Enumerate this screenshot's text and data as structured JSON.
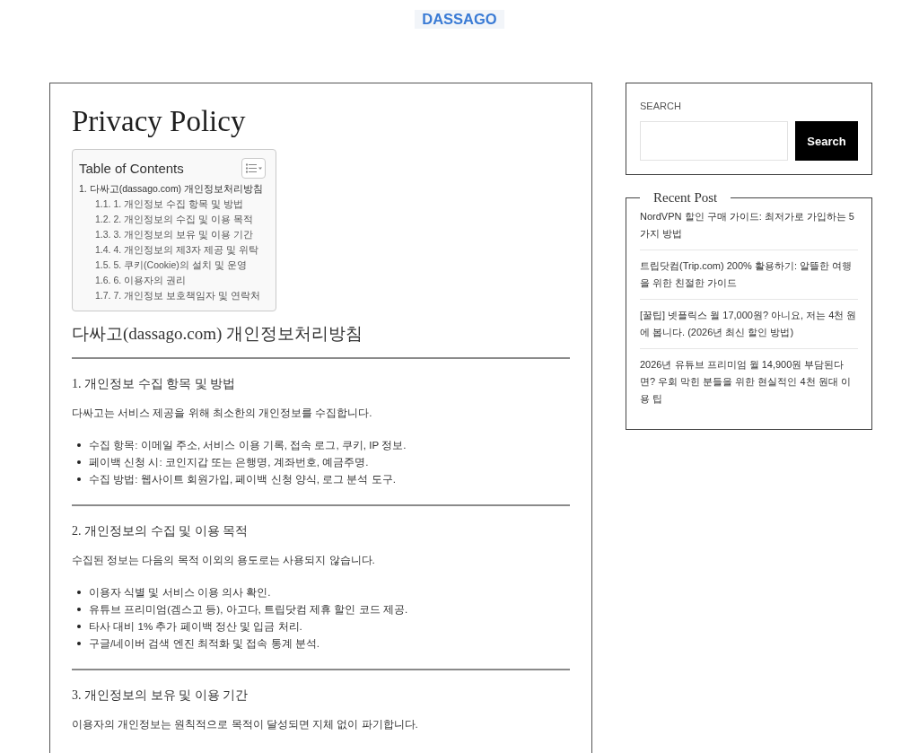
{
  "header": {
    "logo": "DASSAGO"
  },
  "article": {
    "title": "Privacy Policy",
    "toc": {
      "title": "Table of Contents",
      "items": [
        {
          "text": "1. 다싸고(dassago.com) 개인정보처리방침",
          "children": [
            {
              "text": "1.1. 1. 개인정보 수집 항목 및 방법"
            },
            {
              "text": "1.2. 2. 개인정보의 수집 및 이용 목적"
            },
            {
              "text": "1.3. 3. 개인정보의 보유 및 이용 기간"
            },
            {
              "text": "1.4. 4. 개인정보의 제3자 제공 및 위탁"
            },
            {
              "text": "1.5. 5. 쿠키(Cookie)의 설치 및 운영"
            },
            {
              "text": "1.6. 6. 이용자의 권리"
            },
            {
              "text": "1.7. 7. 개인정보 보호책임자 및 연락처"
            }
          ]
        }
      ]
    },
    "heading": "다싸고(dassago.com) 개인정보처리방침",
    "sections": [
      {
        "heading": "1. 개인정보 수집 항목 및 방법",
        "intro": "다싸고는 서비스 제공을 위해 최소한의 개인정보를 수집합니다.",
        "bullets": [
          "수집 항목: 이메일 주소, 서비스 이용 기록, 접속 로그, 쿠키, IP 정보.",
          "페이백 신청 시: 코인지갑 또는 은행명, 계좌번호, 예금주명.",
          "수집 방법: 웹사이트 회원가입, 페이백 신청 양식, 로그 분석 도구."
        ]
      },
      {
        "heading": "2. 개인정보의 수집 및 이용 목적",
        "intro": "수집된 정보는 다음의 목적 이외의 용도로는 사용되지 않습니다.",
        "bullets": [
          "이용자 식별 및 서비스 이용 의사 확인.",
          "유튜브 프리미엄(겜스고 등), 아고다, 트립닷컴 제휴 할인 코드 제공.",
          "타사 대비 1% 추가 페이백 정산 및 입금 처리.",
          "구글/네이버 검색 엔진 최적화 및 접속 통계 분석."
        ]
      },
      {
        "heading": "3. 개인정보의 보유 및 이용 기간",
        "intro": "이용자의 개인정보는 원칙적으로 목적이 달성되면 지체 없이 파기합니다."
      }
    ]
  },
  "sidebar": {
    "search": {
      "label": "SEARCH",
      "button": "Search"
    },
    "recent_posts": {
      "title": "Recent Post",
      "items": [
        "NordVPN 할인 구매 가이드: 최저가로 가입하는 5가지 방법",
        "트립닷컴(Trip.com) 200% 활용하기: 알뜰한 여행을 위한 친절한 가이드",
        "[꿀팁] 넷플릭스 월 17,000원? 아니요, 저는 4천 원에 봅니다. (2026년 최신 할인 방법)",
        "2026년 유튜브 프리미엄 월 14,900원 부담된다면? 우회 막힌 분들을 위한 현실적인 4천 원대 이용 팁"
      ]
    }
  }
}
